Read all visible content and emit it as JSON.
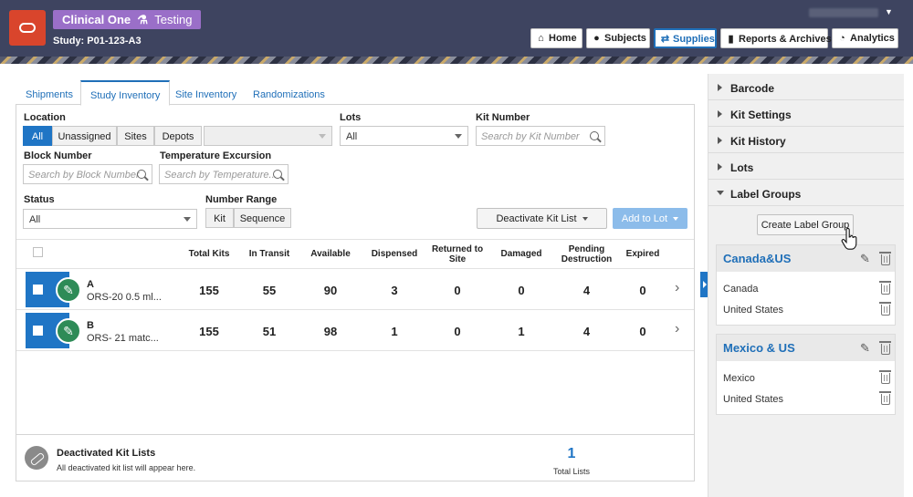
{
  "header": {
    "app_name": "Clinical One",
    "mode": "Testing",
    "study": "Study: P01-123-A3",
    "nav": [
      "Home",
      "Subjects",
      "Supplies",
      "Reports & Archives",
      "Analytics"
    ],
    "active_nav": "Supplies"
  },
  "tabs": [
    "Shipments",
    "Study Inventory",
    "Site Inventory",
    "Randomizations"
  ],
  "active_tab": "Study Inventory",
  "filters": {
    "location_label": "Location",
    "location_options": [
      "All",
      "Unassigned",
      "Sites",
      "Depots"
    ],
    "location_selected": "All",
    "lots_label": "Lots",
    "lots_value": "All",
    "kit_number_label": "Kit Number",
    "kit_number_placeholder": "Search by Kit Number",
    "block_number_label": "Block Number",
    "block_number_placeholder": "Search by Block Number",
    "temp_label": "Temperature Excursion",
    "temp_placeholder": "Search by Temperature...",
    "status_label": "Status",
    "status_value": "All",
    "number_range_label": "Number Range",
    "number_range_options": [
      "Kit",
      "Sequence"
    ]
  },
  "actions": {
    "deactivate": "Deactivate Kit List",
    "add_to_lot": "Add to Lot"
  },
  "table": {
    "columns": [
      "Total Kits",
      "In Transit",
      "Available",
      "Dispensed",
      "Returned to Site",
      "Damaged",
      "Pending Destruction",
      "Expired"
    ],
    "rows": [
      {
        "name": "A",
        "desc": "ORS-20 0.5 ml...",
        "values": [
          "155",
          "55",
          "90",
          "3",
          "0",
          "0",
          "4",
          "0"
        ]
      },
      {
        "name": "B",
        "desc": "ORS- 21 matc...",
        "values": [
          "155",
          "51",
          "98",
          "1",
          "0",
          "1",
          "4",
          "0"
        ]
      }
    ]
  },
  "footer": {
    "title": "Deactivated Kit Lists",
    "subtitle": "All deactivated kit list will appear here.",
    "count": "1",
    "count_label": "Total Lists"
  },
  "sidebar": {
    "sections": [
      "Barcode",
      "Kit Settings",
      "Kit History",
      "Lots",
      "Label Groups"
    ],
    "create_button": "Create Label Group",
    "groups": [
      {
        "name": "Canada&US",
        "items": [
          "Canada",
          "United States"
        ]
      },
      {
        "name": "Mexico & US",
        "items": [
          "Mexico",
          "United States"
        ]
      }
    ]
  },
  "colors": {
    "header": "#3e4460",
    "accent": "#1f75c5",
    "brand": "#d9452c",
    "badge": "#9a6fc8",
    "kit_icon": "#2e8b57"
  }
}
